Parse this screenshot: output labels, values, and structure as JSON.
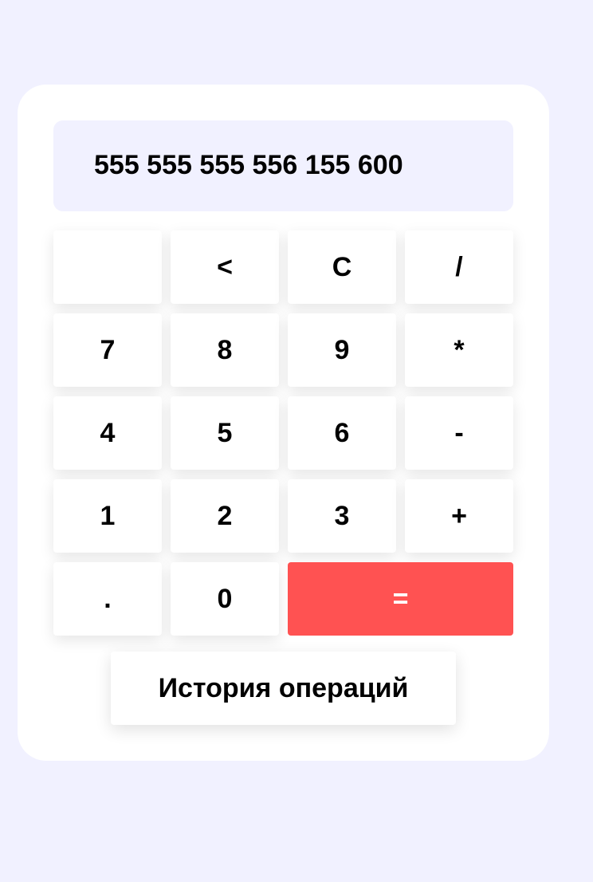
{
  "display": {
    "value": "555 555 555 556 155 600"
  },
  "keys": [
    {
      "label": "",
      "name": "blank-key"
    },
    {
      "label": "<",
      "name": "backspace-button"
    },
    {
      "label": "C",
      "name": "clear-button"
    },
    {
      "label": "/",
      "name": "divide-button"
    },
    {
      "label": "7",
      "name": "digit-7-button"
    },
    {
      "label": "8",
      "name": "digit-8-button"
    },
    {
      "label": "9",
      "name": "digit-9-button"
    },
    {
      "label": "*",
      "name": "multiply-button"
    },
    {
      "label": "4",
      "name": "digit-4-button"
    },
    {
      "label": "5",
      "name": "digit-5-button"
    },
    {
      "label": "6",
      "name": "digit-6-button"
    },
    {
      "label": "-",
      "name": "subtract-button"
    },
    {
      "label": "1",
      "name": "digit-1-button"
    },
    {
      "label": "2",
      "name": "digit-2-button"
    },
    {
      "label": "3",
      "name": "digit-3-button"
    },
    {
      "label": "+",
      "name": "add-button"
    },
    {
      "label": ".",
      "name": "decimal-point-button"
    },
    {
      "label": "0",
      "name": "digit-0-button"
    },
    {
      "label": "=",
      "name": "equals-button"
    }
  ],
  "history": {
    "label": "История операций"
  },
  "colors": {
    "background": "#f1f1ff",
    "panel": "#ffffff",
    "display": "#f1f1ff",
    "equals": "#ff5252"
  }
}
